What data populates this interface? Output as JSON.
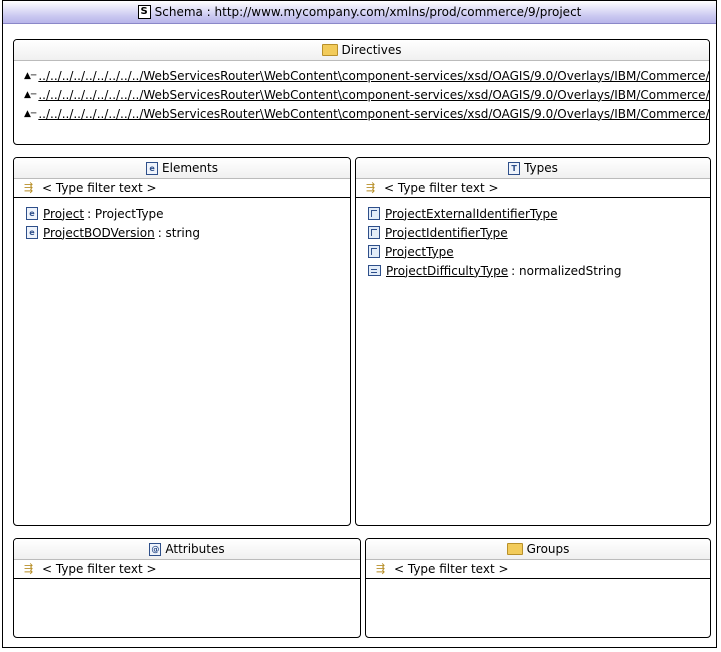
{
  "window": {
    "icon_letter": "S",
    "title": "Schema : http://www.mycompany.com/xmlns/prod/commerce/9/project"
  },
  "directives": {
    "label": "Directives",
    "items": [
      "../../../../../../../../../WebServicesRouter\\WebContent\\component-services/xsd/OAGIS/9.0/Overlays/IBM/Commerce/Resources/",
      "../../../../../../../../../WebServicesRouter\\WebContent\\component-services/xsd/OAGIS/9.0/Overlays/IBM/Commerce/Resources/",
      "../../../../../../../../../WebServicesRouter\\WebContent\\component-services/xsd/OAGIS/9.0/Overlays/IBM/Commerce/Resources/"
    ]
  },
  "elements": {
    "label": "Elements",
    "filter": "< Type filter text >",
    "items": [
      {
        "name": "Project",
        "type": ": ProjectType"
      },
      {
        "name": "ProjectBODVersion",
        "type": ": string"
      }
    ]
  },
  "types": {
    "label": "Types",
    "filter": "< Type filter text >",
    "items": [
      {
        "name": "ProjectExternalIdentifierType",
        "type": "",
        "kind": "complex"
      },
      {
        "name": "ProjectIdentifierType",
        "type": "",
        "kind": "complex"
      },
      {
        "name": "ProjectType",
        "type": "",
        "kind": "complex"
      },
      {
        "name": "ProjectDifficultyType",
        "type": ": normalizedString",
        "kind": "simple"
      }
    ]
  },
  "attributes": {
    "label": "Attributes",
    "filter": "< Type filter text >"
  },
  "groups": {
    "label": "Groups",
    "filter": "< Type filter text >"
  }
}
